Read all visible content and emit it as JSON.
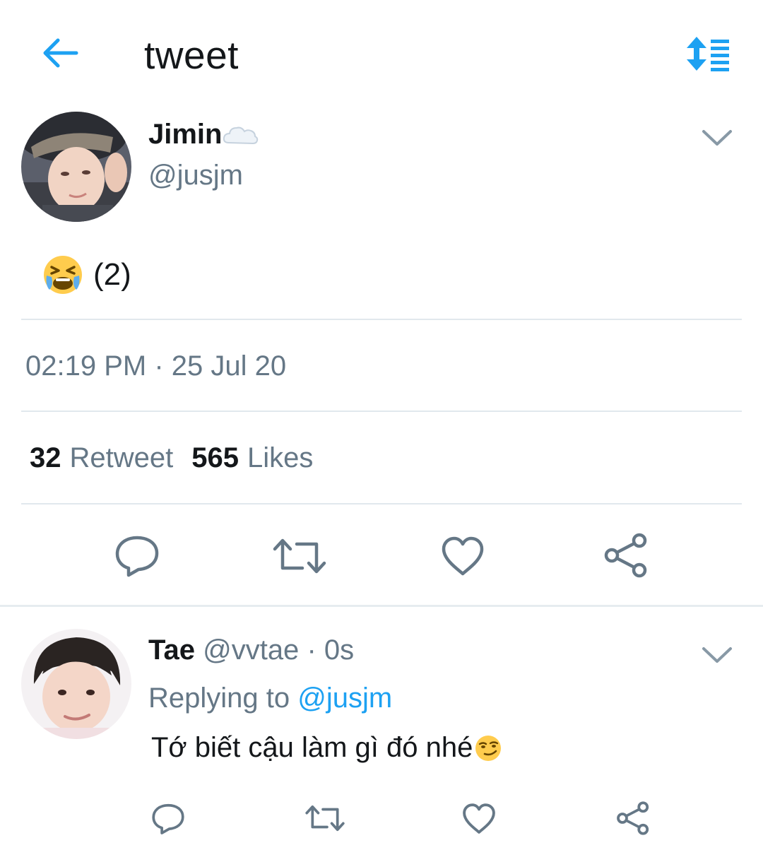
{
  "header": {
    "title": "tweet",
    "back_icon": "arrow-left-icon",
    "sort_icon": "sort-list-icon",
    "accent_color": "#1da1f2"
  },
  "tweet": {
    "author_name": "Jimin",
    "author_handle": "@jusjm",
    "name_icon": "cloud-icon",
    "text": "(2)",
    "text_emoji": "crying-face-emoji",
    "timestamp": "02:19 PM · 25 Jul 20",
    "retweet_count": "32",
    "retweet_label": "Retweet",
    "like_count": "565",
    "like_label": "Likes",
    "actions": [
      "reply-icon",
      "retweet-icon",
      "like-icon",
      "share-icon"
    ]
  },
  "reply": {
    "author_name": "Tae",
    "author_handle": "@vvtae",
    "time": "· 0s",
    "replying_label": "Replying to",
    "replying_to": "@jusjm",
    "text": "Tớ biết cậu làm gì đó nhé",
    "text_emoji": "smirking-face-emoji",
    "actions": [
      "reply-icon",
      "retweet-icon",
      "like-icon",
      "share-icon"
    ]
  }
}
